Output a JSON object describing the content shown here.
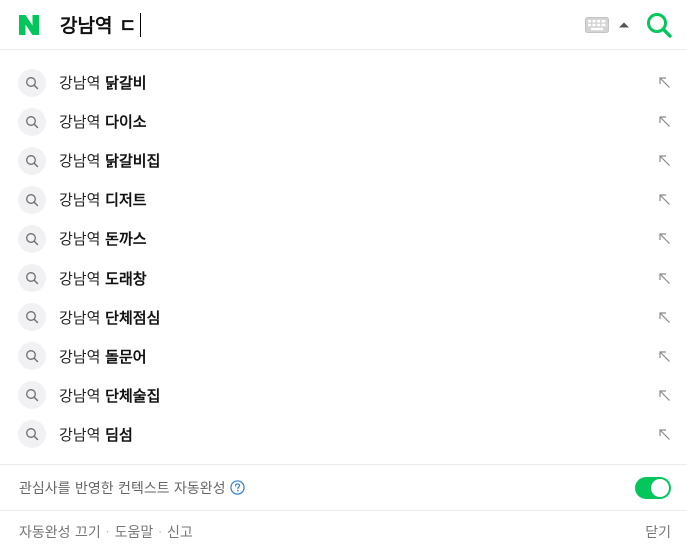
{
  "search": {
    "query": "강남역 ㄷ"
  },
  "suggestions": [
    {
      "prefix": "강남역 ",
      "completion": "닭갈비"
    },
    {
      "prefix": "강남역 ",
      "completion": "다이소"
    },
    {
      "prefix": "강남역 ",
      "completion": "닭갈비집"
    },
    {
      "prefix": "강남역 ",
      "completion": "디저트"
    },
    {
      "prefix": "강남역 ",
      "completion": "돈까스"
    },
    {
      "prefix": "강남역 ",
      "completion": "도래창"
    },
    {
      "prefix": "강남역 ",
      "completion": "단체점심"
    },
    {
      "prefix": "강남역 ",
      "completion": "돌문어"
    },
    {
      "prefix": "강남역 ",
      "completion": "단체술집"
    },
    {
      "prefix": "강남역 ",
      "completion": "딤섬"
    }
  ],
  "context": {
    "label": "관심사를 반영한 컨텍스트 자동완성",
    "toggle_on": true
  },
  "footer": {
    "autocomplete_off": "자동완성 끄기",
    "help": "도움말",
    "report": "신고",
    "close": "닫기"
  },
  "colors": {
    "brand_green": "#03c75a",
    "help_blue": "#2f7fd6"
  },
  "icons": {
    "logo": "naver-n-logo",
    "keyboard": "keyboard-icon",
    "dropdown": "arrow-up-icon",
    "search": "search-icon",
    "suggest": "search-icon",
    "fill": "arrow-up-left-icon",
    "help": "question-circle-icon"
  }
}
